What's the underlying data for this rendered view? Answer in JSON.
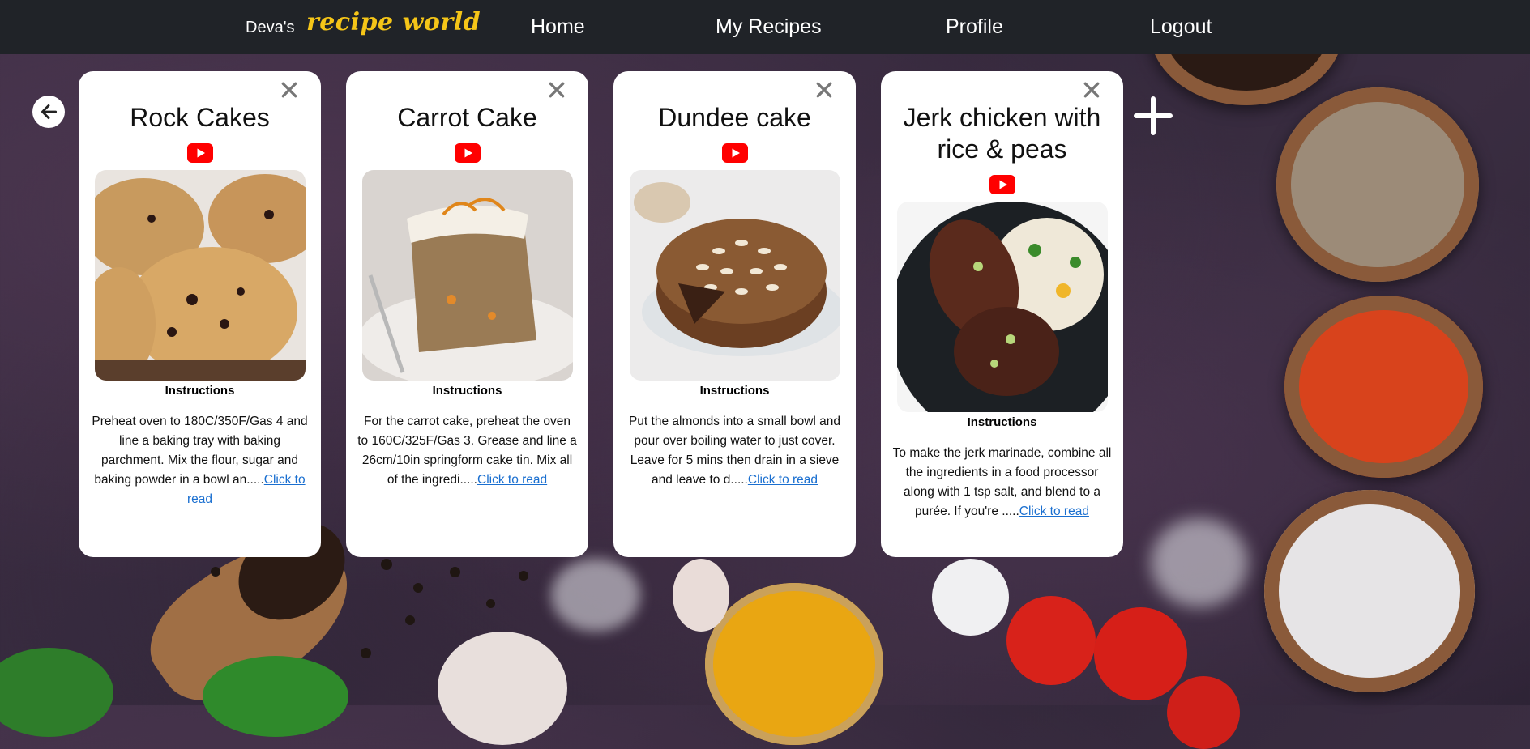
{
  "nav": {
    "brand_prefix": "Deva's",
    "brand_logo": "recipe world",
    "links": [
      "Home",
      "My Recipes",
      "Profile",
      "Logout"
    ]
  },
  "icons": {
    "back": "arrow-left-icon",
    "add": "plus-icon",
    "close": "close-icon",
    "video": "youtube-icon"
  },
  "colors": {
    "nav_bg": "#202328",
    "brand_logo": "#f5c518",
    "youtube": "#ff0000",
    "link": "#1a6fd0"
  },
  "cards": [
    {
      "title": "Rock Cakes",
      "instructions_label": "Instructions",
      "instructions": "Preheat oven to 180C/350F/Gas 4 and line a baking tray with baking parchment. Mix the flour, sugar and baking powder in a bowl an.....",
      "read_link": "Click to read"
    },
    {
      "title": "Carrot Cake",
      "instructions_label": "Instructions",
      "instructions": "For the carrot cake, preheat the oven to 160C/325F/Gas 3. Grease and line a 26cm/10in springform cake tin. Mix all of the ingredi.....",
      "read_link": "Click to read"
    },
    {
      "title": "Dundee cake",
      "instructions_label": "Instructions",
      "instructions": "Put the almonds into a small bowl and pour over boiling water to just cover. Leave for 5 mins then drain in a sieve and leave to d.....",
      "read_link": "Click to read"
    },
    {
      "title": "Jerk chicken with rice & peas",
      "instructions_label": "Instructions",
      "instructions": "To make the jerk marinade, combine all the ingredients in a food processor along with 1 tsp salt, and blend to a purée. If you're .....",
      "read_link": "Click to read"
    }
  ]
}
